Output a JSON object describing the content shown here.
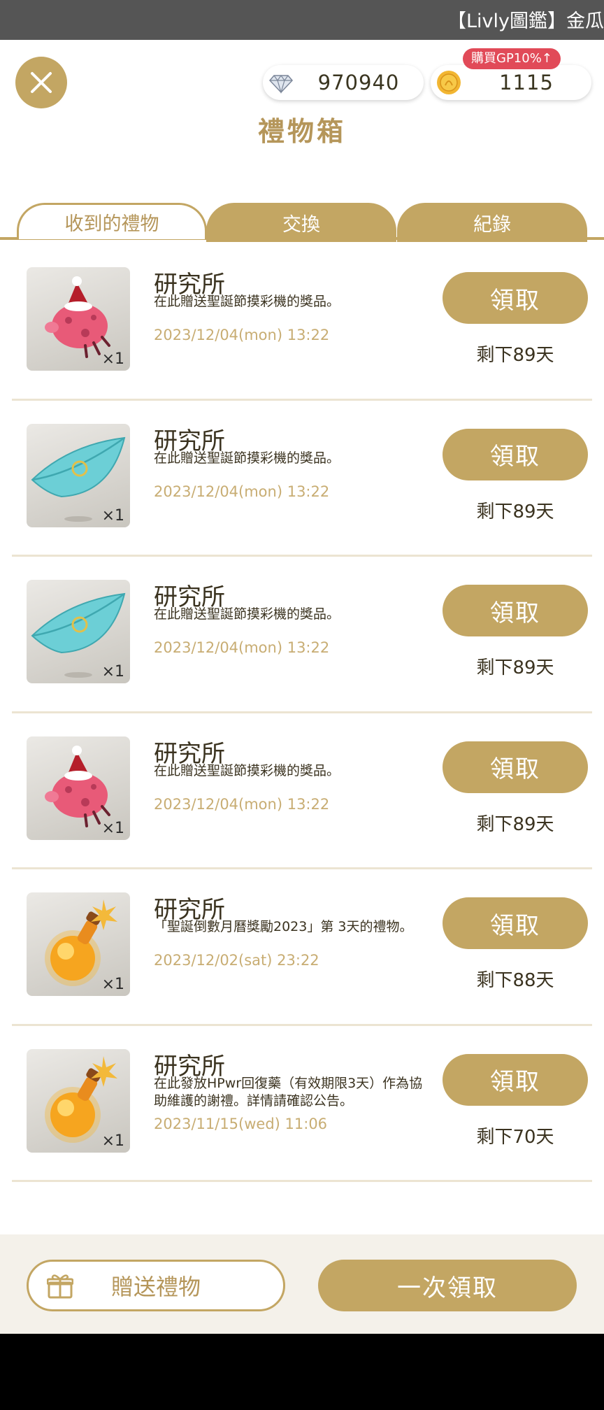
{
  "window": {
    "title": "【Livly圖鑑】金瓜"
  },
  "header": {
    "gems": "970940",
    "gold": "1115",
    "promo": "購買GP10%↑",
    "title": "禮物箱"
  },
  "tabs": [
    {
      "label": "收到的禮物",
      "active": true
    },
    {
      "label": "交換",
      "active": false
    },
    {
      "label": "紀錄",
      "active": false
    }
  ],
  "gifts": [
    {
      "item_icon": "pig-plush-icon",
      "quantity": "×1",
      "sender": "研究所",
      "message": "在此贈送聖誕節摸彩機的獎品。",
      "date": "2023/12/04(mon) 13:22",
      "claim_label": "領取",
      "remaining": "剩下89天"
    },
    {
      "item_icon": "leaf-icon",
      "quantity": "×1",
      "sender": "研究所",
      "message": "在此贈送聖誕節摸彩機的獎品。",
      "date": "2023/12/04(mon) 13:22",
      "claim_label": "領取",
      "remaining": "剩下89天"
    },
    {
      "item_icon": "leaf-icon",
      "quantity": "×1",
      "sender": "研究所",
      "message": "在此贈送聖誕節摸彩機的獎品。",
      "date": "2023/12/04(mon) 13:22",
      "claim_label": "領取",
      "remaining": "剩下89天"
    },
    {
      "item_icon": "pig-plush-icon",
      "quantity": "×1",
      "sender": "研究所",
      "message": "在此贈送聖誕節摸彩機的獎品。",
      "date": "2023/12/04(mon) 13:22",
      "claim_label": "領取",
      "remaining": "剩下89天"
    },
    {
      "item_icon": "potion-icon",
      "quantity": "×1",
      "sender": "研究所",
      "message": "「聖誕倒數月曆獎勵2023」第 3天的禮物。",
      "date": "2023/12/02(sat) 23:22",
      "claim_label": "領取",
      "remaining": "剩下88天"
    },
    {
      "item_icon": "potion-icon",
      "quantity": "×1",
      "sender": "研究所",
      "message": "在此發放HPwr回復藥（有效期限3天）作為協助維護的謝禮。詳情請確認公告。",
      "date": "2023/11/15(wed) 11:06",
      "claim_label": "領取",
      "remaining": "剩下70天"
    }
  ],
  "footer": {
    "send_label": "贈送禮物",
    "claim_all_label": "一次領取"
  },
  "colors": {
    "accent": "#c3a663",
    "promo": "#e14a58",
    "text": "#3b3320"
  }
}
